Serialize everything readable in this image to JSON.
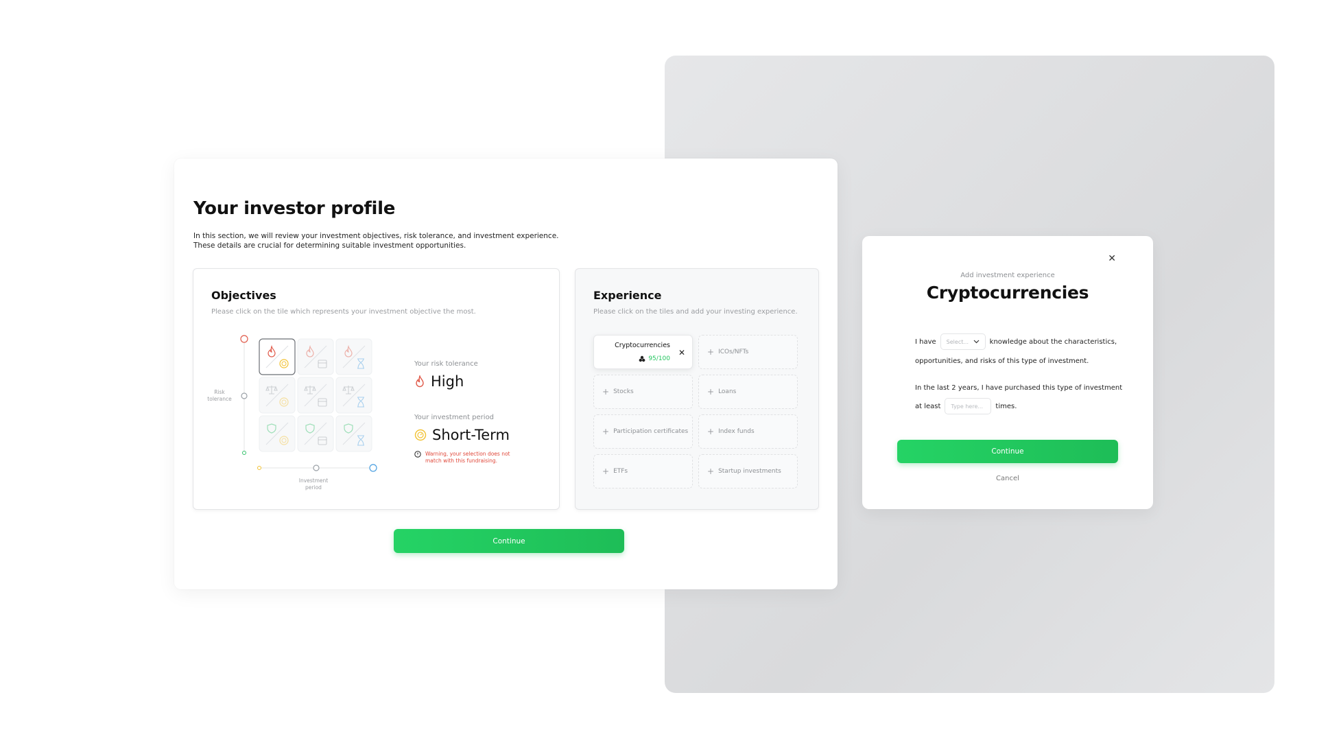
{
  "page": {
    "title": "Your investor profile",
    "description_line1": "In this section, we will review your investment objectives, risk tolerance, and investment experience.",
    "description_line2": "These details are crucial for determining suitable investment opportunities.",
    "continue_label": "Continue"
  },
  "objectives": {
    "title": "Objectives",
    "subtitle": "Please click on the tile which represents your investment objective the most.",
    "y_axis_label": "Risk tolerance",
    "x_axis_label": "Investment period",
    "selected_cell": {
      "row": 0,
      "col": 0
    },
    "risk_label": "Your risk tolerance",
    "risk_value": "High",
    "period_label": "Your investment period",
    "period_value": "Short-Term",
    "warning": "Warning, your selection does not match with this fundraising.",
    "colors": {
      "high": "#e05a4a",
      "short": "#f2c233",
      "medium": "#9aa0a6",
      "low": "#34c26b",
      "long": "#4a9fe0"
    }
  },
  "experience": {
    "title": "Experience",
    "subtitle": "Please click on the tiles and add your investing experience.",
    "active_tile": {
      "name": "Cryptocurrencies",
      "score": "95/100"
    },
    "tiles": [
      "ICOs/NFTs",
      "Stocks",
      "Loans",
      "Participation certificates",
      "Index funds",
      "ETFs",
      "Startup investments"
    ]
  },
  "modal": {
    "kicker": "Add investment experience",
    "title": "Cryptocurrencies",
    "line1_prefix": "I have",
    "select_placeholder": "Select...",
    "line1_suffix": "knowledge about the characteristics,",
    "line2": "opportunities, and risks of this type of investment.",
    "line3": "In the last 2 years, I have purchased this type of investment",
    "line4_prefix": "at least",
    "input_placeholder": "Type here...",
    "line4_suffix": "times.",
    "continue_label": "Continue",
    "cancel_label": "Cancel",
    "close_icon": "close-icon"
  }
}
